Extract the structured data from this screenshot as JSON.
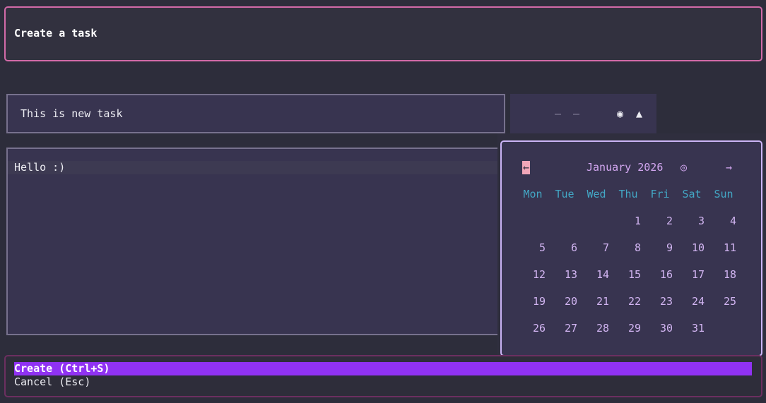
{
  "header": {
    "title": "Create a task"
  },
  "form": {
    "title_value": "This is new task",
    "description_value": "Hello :)"
  },
  "date_strip": {
    "month_placeholder": "–",
    "day_placeholder": "–",
    "target_icon": "◉",
    "collapse_icon": "▲"
  },
  "calendar": {
    "prev_icon": "←",
    "month_label": "January 2026",
    "today_icon": "◎",
    "next_icon": "→",
    "weekdays": [
      "Mon",
      "Tue",
      "Wed",
      "Thu",
      "Fri",
      "Sat",
      "Sun"
    ],
    "weeks": [
      [
        "",
        "",
        "",
        "1",
        "2",
        "3",
        "4"
      ],
      [
        "5",
        "6",
        "7",
        "8",
        "9",
        "10",
        "11"
      ],
      [
        "12",
        "13",
        "14",
        "15",
        "16",
        "17",
        "18"
      ],
      [
        "19",
        "20",
        "21",
        "22",
        "23",
        "24",
        "25"
      ],
      [
        "26",
        "27",
        "28",
        "29",
        "30",
        "31",
        ""
      ]
    ]
  },
  "footer": {
    "create_label": "Create (Ctrl+S)",
    "cancel_label": "Cancel (Esc)"
  },
  "colors": {
    "background": "#2d2d3b",
    "header_border": "#d26aa8",
    "field_border": "#77718d",
    "calendar_border": "#cbb4f6",
    "weekday_text": "#43a7c5",
    "day_text": "#d2b5f2",
    "create_highlight": "#9032f3"
  }
}
